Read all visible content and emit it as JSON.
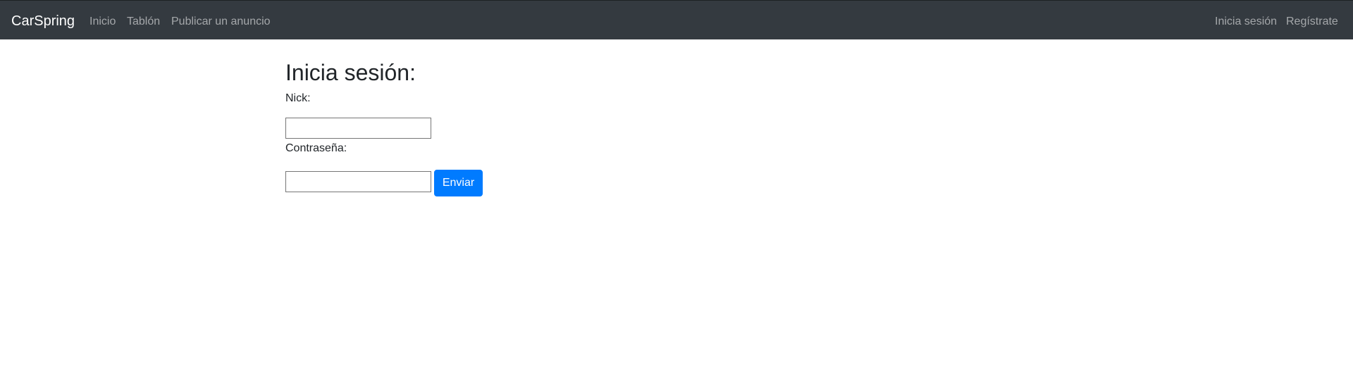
{
  "navbar": {
    "brand": "CarSpring",
    "left_links": [
      "Inicio",
      "Tablón",
      "Publicar un anuncio"
    ],
    "right_links": [
      "Inicia sesión",
      "Regístrate"
    ]
  },
  "login": {
    "title": "Inicia sesión:",
    "nick_label": "Nick:",
    "nick_value": "",
    "password_label": "Contraseña:",
    "password_value": "",
    "submit_label": "Enviar"
  },
  "colors": {
    "navbar_bg": "#343a40",
    "primary": "#007bff",
    "text": "#212529"
  }
}
